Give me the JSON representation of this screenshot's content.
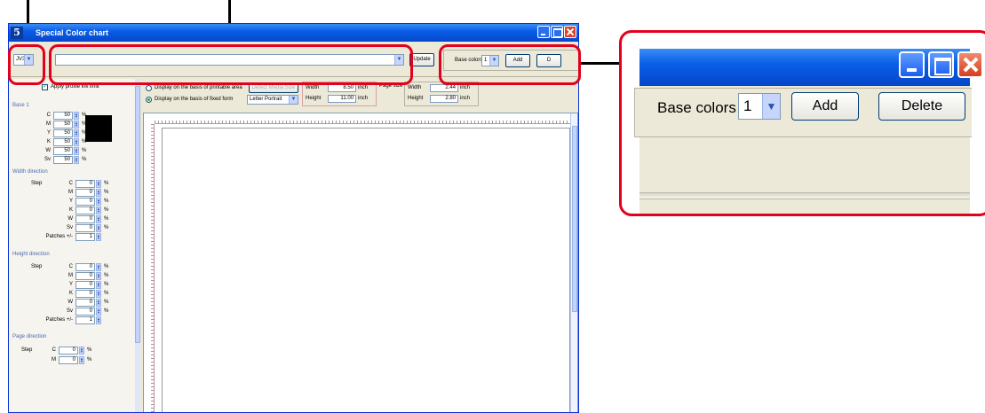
{
  "window": {
    "title": "Special Color chart"
  },
  "toolbar": {
    "printer": "JV33",
    "update_label": "Update",
    "base_colors_label": "Base colors",
    "base_colors_value": "1",
    "add_label": "Add",
    "delete_label": "D"
  },
  "left_panel": {
    "apply_ink_limit": "Apply profile ink limit",
    "base_title": "Base 1",
    "base_rows": [
      {
        "label": "C",
        "value": "50",
        "unit": "%"
      },
      {
        "label": "M",
        "value": "50",
        "unit": "%"
      },
      {
        "label": "Y",
        "value": "50",
        "unit": "%"
      },
      {
        "label": "K",
        "value": "50",
        "unit": "%"
      },
      {
        "label": "W",
        "value": "50",
        "unit": "%"
      },
      {
        "label": "Sv",
        "value": "50",
        "unit": "%"
      }
    ],
    "swatch_color": "#000000",
    "width_title": "Width direction",
    "step_label": "Step",
    "width_rows": [
      {
        "label": "C",
        "value": "0",
        "unit": "%"
      },
      {
        "label": "M",
        "value": "0",
        "unit": "%"
      },
      {
        "label": "Y",
        "value": "0",
        "unit": "%"
      },
      {
        "label": "K",
        "value": "0",
        "unit": "%"
      },
      {
        "label": "W",
        "value": "0",
        "unit": "%"
      },
      {
        "label": "Sv",
        "value": "0",
        "unit": "%"
      }
    ],
    "patches_label": "Patches +/-",
    "width_patches": "1",
    "height_title": "Height direction",
    "height_rows": [
      {
        "label": "C",
        "value": "0",
        "unit": "%"
      },
      {
        "label": "M",
        "value": "0",
        "unit": "%"
      },
      {
        "label": "Y",
        "value": "0",
        "unit": "%"
      },
      {
        "label": "K",
        "value": "0",
        "unit": "%"
      },
      {
        "label": "W",
        "value": "0",
        "unit": "%"
      },
      {
        "label": "Sv",
        "value": "0",
        "unit": "%"
      }
    ],
    "height_patches": "1",
    "page_title": "Page direction",
    "page_rows": [
      {
        "label": "C",
        "value": "0",
        "unit": "%"
      },
      {
        "label": "M",
        "value": "0",
        "unit": "%"
      }
    ]
  },
  "options": {
    "printable_area_label": "Display on the basis of printable area",
    "detect_media_label": "Detect Media Size",
    "fixed_form_label": "Display on the basis of fixed form",
    "fixed_form_value": "Letter Portrait",
    "width_label": "Width",
    "width_value": "8.50",
    "height_label": "Height",
    "height_value": "11.00",
    "unit": "inch",
    "page_size_label": "Page size",
    "page_width_label": "Width",
    "page_width_value": "2.44",
    "page_height_label": "Height",
    "page_height_value": "2.80"
  },
  "zoom": {
    "base_colors_label": "Base colors",
    "base_colors_value": "1",
    "add_label": "Add",
    "delete_label": "Delete"
  },
  "colors": {
    "highlight": "#e3001b",
    "titlebar": "#0a5ee8"
  }
}
